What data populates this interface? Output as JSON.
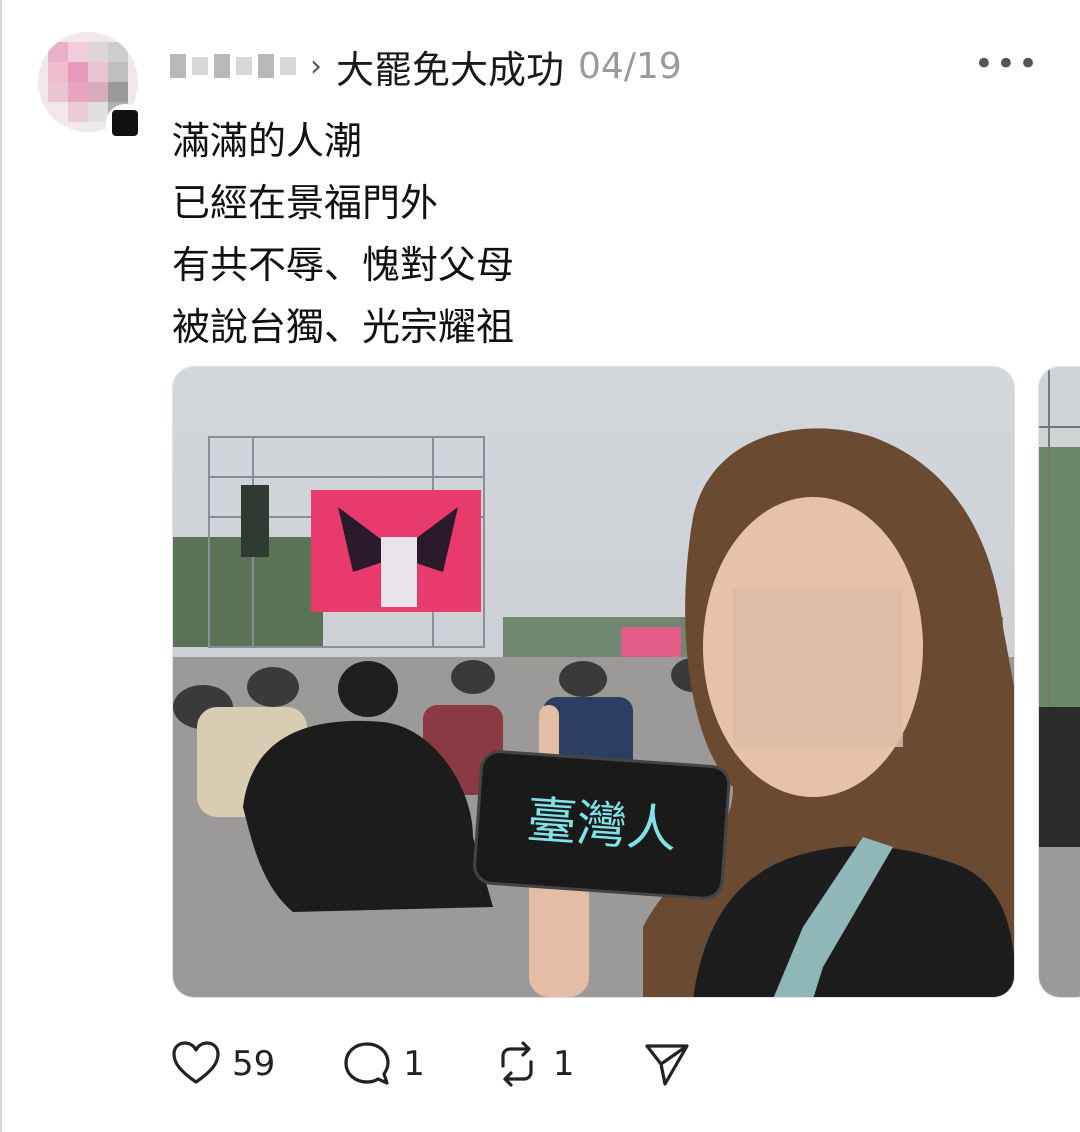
{
  "post": {
    "username_display": "",
    "separator": "›",
    "topic": "大罷免大成功",
    "date": "04/19",
    "more_label": "•••",
    "lines": [
      "滿滿的人潮",
      "已經在景福門外",
      "有共不辱、愧對父母",
      "被說台獨、光宗耀祖"
    ],
    "phone_screen_text": "臺灣人"
  },
  "actions": {
    "likes": "59",
    "replies": "1",
    "reposts": "1"
  },
  "colors": {
    "accent_screen": "#e83a6d",
    "phone_text": "#7fe3e8"
  }
}
